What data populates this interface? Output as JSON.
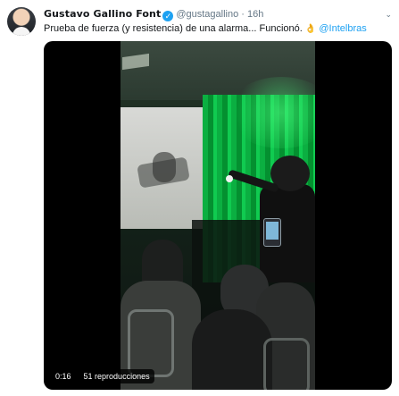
{
  "tweet": {
    "author_name": "Gustavo Gallino Font",
    "verified_glyph": "✓",
    "handle": "@gustagallino",
    "separator": "·",
    "time": "16h",
    "text": "Prueba de fuerza (y resistencia) de una alarma... Funcionó. ",
    "emoji": "👌",
    "mention": "@Intelbras",
    "menu_glyph": "⌄"
  },
  "video": {
    "duration": "0:16",
    "views": "51 reproducciones"
  },
  "icons": {
    "avatar": "avatar-photo",
    "verified": "verified-badge-icon",
    "menu": "chevron-down-icon"
  },
  "colors": {
    "link": "#1da1f2",
    "secondary_text": "#657786",
    "primary_text": "#14171a"
  }
}
